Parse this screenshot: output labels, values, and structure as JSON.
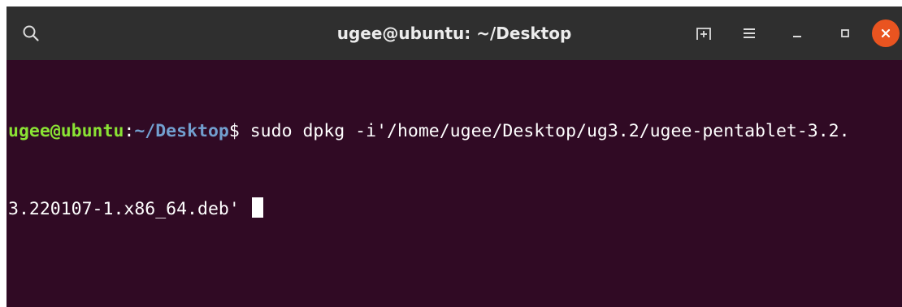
{
  "window": {
    "title": "ugee@ubuntu: ~/Desktop"
  },
  "titlebar": {
    "search_icon": "search-icon",
    "new_tab_icon": "new-tab-icon",
    "menu_icon": "hamburger-menu-icon",
    "minimize_icon": "minimize-icon",
    "maximize_icon": "maximize-icon",
    "close_icon": "close-icon"
  },
  "terminal": {
    "prompt_user_host": "ugee@ubuntu",
    "prompt_colon": ":",
    "prompt_path": "~/Desktop",
    "prompt_dollar": "$",
    "command_line_1": " sudo dpkg -i'/home/ugee/Desktop/ug3.2/ugee-pentablet-3.2.",
    "command_line_2": "3.220107-1.x86_64.deb' "
  },
  "colors": {
    "terminal_background": "#300a24",
    "titlebar_background": "#2f2f2f",
    "prompt_user_color": "#8ae234",
    "prompt_path_color": "#729fcf",
    "close_button_color": "#e95420"
  }
}
